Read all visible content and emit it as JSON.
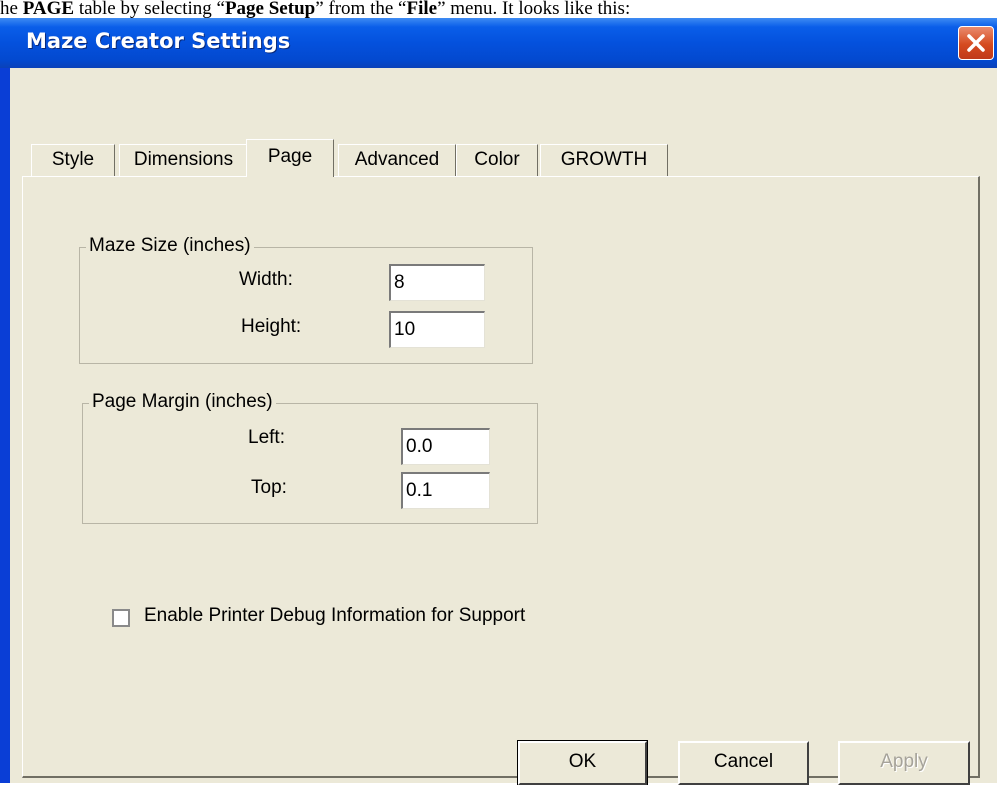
{
  "document": {
    "prefix": "he ",
    "page_word": "PAGE",
    "mid": " table by selecting “",
    "page_setup": "Page Setup",
    "mid2": "” from the “",
    "file_word": "File",
    "suffix": "” menu.  It looks like this:"
  },
  "window": {
    "title": "Maze Creator Settings",
    "close_icon": "close-icon"
  },
  "tabs": [
    {
      "label": "Style",
      "active": false
    },
    {
      "label": "Dimensions",
      "active": false
    },
    {
      "label": "Page",
      "active": true
    },
    {
      "label": "Advanced",
      "active": false
    },
    {
      "label": "Color",
      "active": false
    },
    {
      "label": "GROWTH",
      "active": false
    }
  ],
  "maze_size": {
    "legend": "Maze Size (inches)",
    "width_label": "Width:",
    "width_value": "8",
    "height_label": "Height:",
    "height_value": "10"
  },
  "page_margin": {
    "legend": "Page Margin (inches)",
    "left_label": "Left:",
    "left_value": "0.0",
    "top_label": "Top:",
    "top_value": "0.1"
  },
  "debug_checkbox": {
    "label": "Enable Printer Debug Information for Support",
    "checked": false
  },
  "buttons": {
    "ok": "OK",
    "cancel": "Cancel",
    "apply": "Apply"
  }
}
